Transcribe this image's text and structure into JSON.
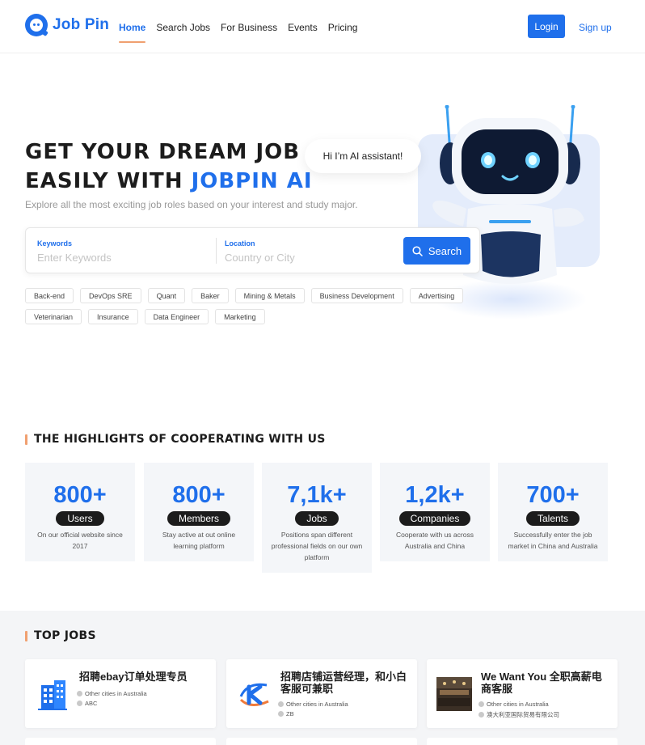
{
  "brand": {
    "name": "Job Pin",
    "accent": "#1f6feb",
    "highlight": "#f0a070"
  },
  "nav": {
    "items": [
      {
        "label": "Home",
        "active": true
      },
      {
        "label": "Search Jobs",
        "active": false
      },
      {
        "label": "For Business",
        "active": false
      },
      {
        "label": "Events",
        "active": false
      },
      {
        "label": "Pricing",
        "active": false
      }
    ],
    "login": "Login",
    "signup": "Sign up"
  },
  "hero": {
    "line1": "GET YOUR DREAM JOB",
    "line2_prefix": "EASILY WITH ",
    "line2_accent": "JOBPIN AI",
    "subtitle": "Explore all the most exciting job roles based on your interest and study major.",
    "bubble": "Hi I’m AI assistant!"
  },
  "search": {
    "keywords_label": "Keywords",
    "keywords_placeholder": "Enter Keywords",
    "location_label": "Location",
    "location_placeholder": "Country or City",
    "button": "Search"
  },
  "tags": [
    "Back-end",
    "DevOps SRE",
    "Quant",
    "Baker",
    "Mining & Metals",
    "Business Development",
    "Advertising",
    "Veterinarian",
    "Insurance",
    "Data Engineer",
    "Marketing"
  ],
  "highlights": {
    "title": "THE HIGHLIGHTS OF COOPERATING WITH US",
    "stats": [
      {
        "value": "800+",
        "label": "Users",
        "desc": "On our official website since 2017"
      },
      {
        "value": "800+",
        "label": "Members",
        "desc": "Stay active at out online learning platform"
      },
      {
        "value": "7,1k+",
        "label": "Jobs",
        "desc": "Positions span different professional fields on our own platform"
      },
      {
        "value": "1,2k+",
        "label": "Companies",
        "desc": "Cooperate with us across Australia and China"
      },
      {
        "value": "700+",
        "label": "Talents",
        "desc": "Successfully enter the job market in China and Australia"
      }
    ]
  },
  "top_jobs": {
    "title": "TOP JOBS",
    "jobs": [
      {
        "title": "招聘ebay订单处理专员",
        "location": "Other cities in Australia",
        "company": "ABC",
        "logo": "building-icon"
      },
      {
        "title": "招聘店铺运营经理，和小白客服可兼职",
        "location": "Other cities in Australia",
        "company": "ZB",
        "logo": "k-brand-icon"
      },
      {
        "title": "We Want You 全职高薪电商客服",
        "location": "Other cities in Australia",
        "company": "澳大利亚国际贸易有限公司",
        "logo": "office-photo"
      }
    ]
  }
}
